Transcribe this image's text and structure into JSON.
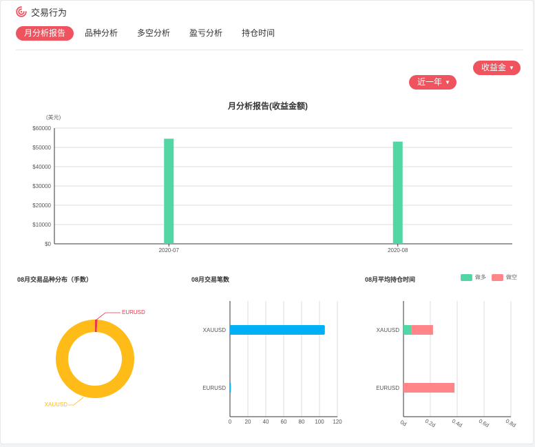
{
  "header": {
    "title": "交易行为",
    "icon": "activity-spiral-icon",
    "accent": "#ef545e"
  },
  "tabs": [
    {
      "label": "月分析报告",
      "active": true
    },
    {
      "label": "品种分析",
      "active": false
    },
    {
      "label": "多空分析",
      "active": false
    },
    {
      "label": "盈亏分析",
      "active": false
    },
    {
      "label": "持仓时间",
      "active": false
    }
  ],
  "filters": {
    "metric_label": "收益金",
    "period_label": "近一年"
  },
  "colors": {
    "accent": "#ef545e",
    "bar_green": "#52d6a4",
    "blue": "#00b0f6",
    "pink": "#ff8589",
    "gold": "#ffbb18",
    "eur": "#e8394a"
  },
  "legend": {
    "long": "做多",
    "short": "做空"
  },
  "chart_data": [
    {
      "type": "bar",
      "title": "月分析报告(收益金额)",
      "unit": "(美元)",
      "categories": [
        "2020-07",
        "2020-08"
      ],
      "values": [
        54500,
        53000
      ],
      "ylim": [
        0,
        60000
      ],
      "yticks": [
        "$0",
        "$10000",
        "$20000",
        "$30000",
        "$40000",
        "$50000",
        "$60000"
      ],
      "grid": true
    },
    {
      "type": "pie",
      "title": "08月交易品种分布（手数）",
      "labels": [
        "EURUSD",
        "XAUUSD"
      ],
      "values": [
        1,
        99
      ]
    },
    {
      "type": "bar",
      "orientation": "horizontal",
      "title": "08月交易笔数",
      "categories": [
        "XAUUSD",
        "EURUSD"
      ],
      "values": [
        106,
        1
      ],
      "xlim": [
        0,
        120
      ],
      "xticks": [
        "0",
        "20",
        "40",
        "60",
        "80",
        "100",
        "120"
      ]
    },
    {
      "type": "bar",
      "orientation": "horizontal",
      "stacked": true,
      "title": "08月平均持仓时间",
      "categories": [
        "XAUUSD",
        "EURUSD"
      ],
      "series": [
        {
          "name": "做多",
          "values": [
            0.06,
            0
          ]
        },
        {
          "name": "做空",
          "values": [
            0.16,
            0.38
          ]
        }
      ],
      "xlim": [
        0,
        0.8
      ],
      "xticks": [
        "0d",
        "0.2d",
        "0.4d",
        "0.6d",
        "0.8d"
      ]
    }
  ]
}
